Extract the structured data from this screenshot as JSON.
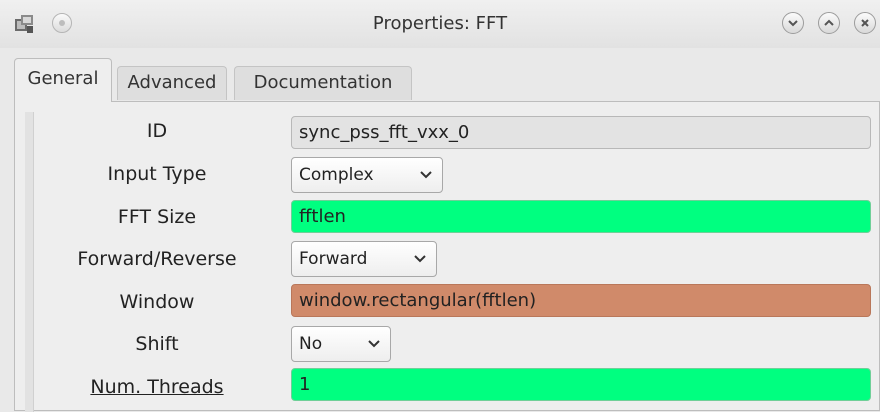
{
  "window": {
    "title": "Properties: FFT",
    "icons": {
      "app": "gnuradio-app-icon",
      "pin": "pin-icon",
      "minimize": "chevron-down-icon",
      "maximize": "chevron-up-icon",
      "close": "close-icon"
    }
  },
  "tabs": [
    {
      "label": "General",
      "active": true
    },
    {
      "label": "Advanced",
      "active": false
    },
    {
      "label": "Documentation",
      "active": false
    }
  ],
  "params": {
    "id": {
      "label": "ID",
      "value": "sync_pss_fft_vxx_0"
    },
    "input_type": {
      "label": "Input Type",
      "value": "Complex"
    },
    "fft_size": {
      "label": "FFT Size",
      "value": "fftlen"
    },
    "direction": {
      "label": "Forward/Reverse",
      "value": "Forward"
    },
    "window": {
      "label": "Window",
      "value": "window.rectangular(fftlen)"
    },
    "shift": {
      "label": "Shift",
      "value": "No"
    },
    "threads": {
      "label": "Num. Threads",
      "value": "1"
    }
  },
  "colors": {
    "int_field": "#00ff80",
    "raw_field": "#d08a6a",
    "id_field": "#e3e3e3"
  }
}
